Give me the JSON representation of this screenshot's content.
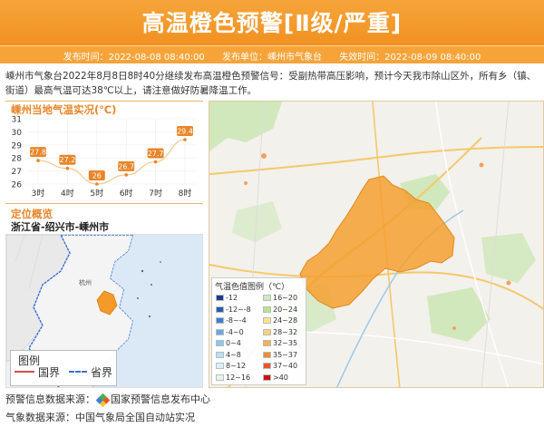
{
  "header": {
    "title": "高温橙色预警[Ⅱ级/严重]",
    "issue_time": "发布时间：2022-08-08 08:40:00",
    "issuer": "发布单位：嵊州市气象台",
    "expire_time": "失效时间：2022-08-09 08:40:00",
    "color": "#f39a2a"
  },
  "description": "嵊州市气象台2022年8月8日8时40分继续发布高温橙色预警信号：受副热带高压影响，预计今天我市除山区外，所有乡（镇、街道）最高气温可达38℃以上，请注意做好防暑降温工作。",
  "chart_section": {
    "title": "嵊州当地气温实况(℃)"
  },
  "location_section": {
    "title": "定位概览",
    "path": "浙江省-绍兴市-嵊州市"
  },
  "province_map": {
    "city_label": "杭州",
    "legend_title": "图例",
    "legend_border": "国界",
    "legend_province": "省界"
  },
  "temp_legend": {
    "title": "气温色值图例（℃）",
    "items": [
      {
        "label": "-12",
        "color": "#1c3d8f"
      },
      {
        "label": "16~20",
        "color": "#c8ecc0"
      },
      {
        "label": "-12~-8",
        "color": "#2a5ab0"
      },
      {
        "label": "20~24",
        "color": "#b7e48a"
      },
      {
        "label": "-8~-4",
        "color": "#3b7fd6"
      },
      {
        "label": "24~28",
        "color": "#ffe58a"
      },
      {
        "label": "-4~0",
        "color": "#67a8ea"
      },
      {
        "label": "28~32",
        "color": "#fcd278"
      },
      {
        "label": "0~4",
        "color": "#8cc6f2"
      },
      {
        "label": "32~35",
        "color": "#f8b152"
      },
      {
        "label": "4~8",
        "color": "#b8e0f7"
      },
      {
        "label": "35~37",
        "color": "#f28a2e"
      },
      {
        "label": "8~12",
        "color": "#d9f1f8"
      },
      {
        "label": "37~40",
        "color": "#e8542a"
      },
      {
        "label": "12~16",
        "color": "#e6f7e6"
      },
      {
        "label": ">40",
        "color": "#c81414"
      }
    ]
  },
  "footer": {
    "source1_prefix": "预警信息数据来源：",
    "source1_name": "国家预警信息发布中心",
    "source2": "气象数据来源：中国气象局全国自动站实况"
  },
  "chart_data": {
    "type": "line",
    "categories": [
      "3时",
      "4时",
      "5时",
      "6时",
      "7时",
      "8时"
    ],
    "values": [
      27.8,
      27.2,
      26,
      26.7,
      27.7,
      29.4
    ],
    "yticks": [
      26,
      27,
      28,
      29,
      30,
      31
    ],
    "ylim": [
      26,
      31
    ],
    "title": "嵊州当地气温实况(℃)",
    "line_color": "#e8862a"
  }
}
